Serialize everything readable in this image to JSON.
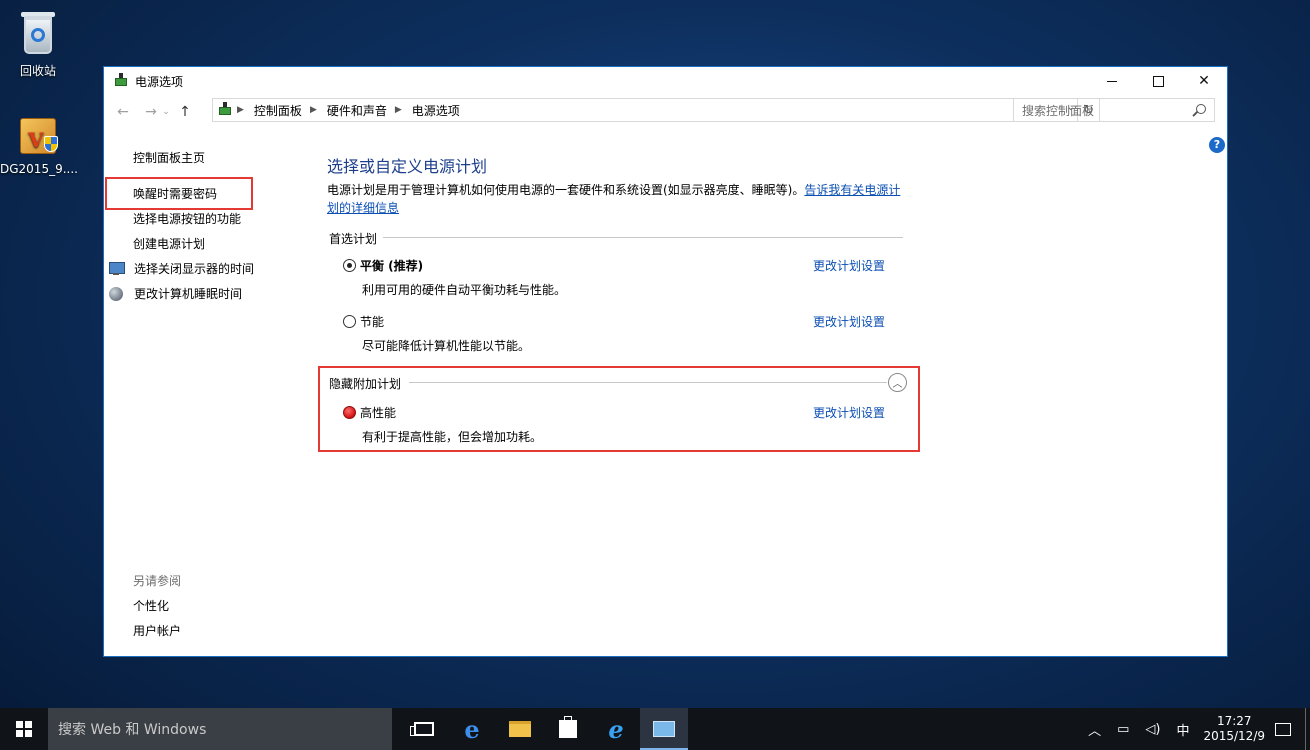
{
  "desktop": {
    "icons": [
      {
        "label": "回收站",
        "icon": "recycle-bin-icon"
      },
      {
        "label": "DG2015_9....",
        "icon": "installer-box-icon"
      }
    ]
  },
  "window": {
    "title": "电源选项",
    "controls": {
      "minimize": "minimize",
      "maximize": "maximize",
      "close": "✕"
    },
    "address": {
      "breadcrumbs": [
        "控制面板",
        "硬件和声音",
        "电源选项"
      ]
    },
    "search": {
      "placeholder": "搜索控制面板"
    },
    "help_label": "?"
  },
  "left_nav": {
    "home": "控制面板主页",
    "items": [
      "唤醒时需要密码",
      "选择电源按钮的功能",
      "创建电源计划",
      "选择关闭显示器的时间",
      "更改计算机睡眠时间"
    ],
    "see_also_title": "另请参阅",
    "see_also": [
      "个性化",
      "用户帐户"
    ]
  },
  "main": {
    "heading": "选择或自定义电源计划",
    "description": "电源计划是用于管理计算机如何使用电源的一套硬件和系统设置(如显示器亮度、睡眠等)。",
    "description_link": "告诉我有关电源计划的详细信息",
    "preferred_title": "首选计划",
    "hidden_title": "隐藏附加计划",
    "change_label": "更改计划设置",
    "plans": [
      {
        "name": "平衡 (推荐)",
        "detail": "利用可用的硬件自动平衡功耗与性能。",
        "selected": true
      },
      {
        "name": "节能",
        "detail": "尽可能降低计算机性能以节能。",
        "selected": false
      },
      {
        "name": "高性能",
        "detail": "有利于提高性能，但会增加功耗。",
        "selected": false
      }
    ]
  },
  "taskbar": {
    "search_placeholder": "搜索 Web 和 Windows",
    "apps": [
      "task-view-icon",
      "edge-icon",
      "file-explorer-icon",
      "store-icon",
      "internet-explorer-icon",
      "control-panel-icon"
    ],
    "ime": "中",
    "time": "17:27",
    "date": "2015/12/9"
  },
  "colors": {
    "accent_link": "#0b4fb4",
    "heading": "#1e3f8c",
    "highlight_box": "#e53935",
    "window_border": "#1c6fc0"
  }
}
